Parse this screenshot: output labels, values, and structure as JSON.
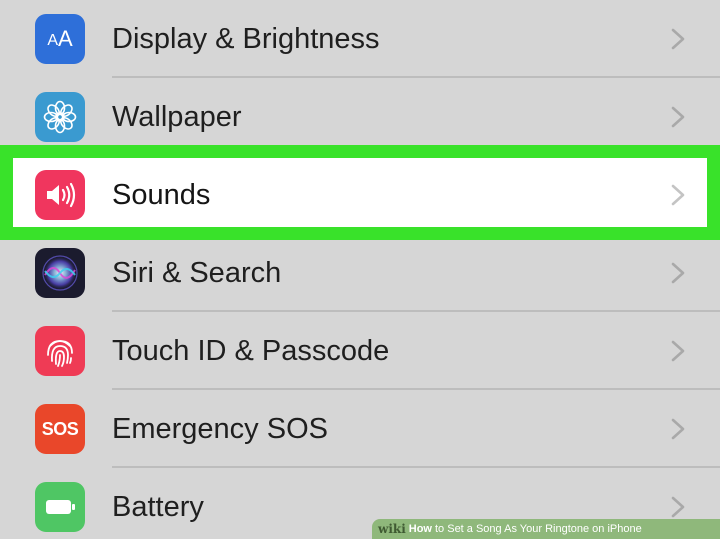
{
  "settings_rows": [
    {
      "label": "Display & Brightness",
      "icon": "display-brightness-icon",
      "icon_color": "#2e6fd9"
    },
    {
      "label": "Wallpaper",
      "icon": "wallpaper-flower-icon",
      "icon_color": "#3a9ad0"
    },
    {
      "label": "Sounds",
      "icon": "speaker-icon",
      "icon_color": "#f0365e",
      "highlighted": true
    },
    {
      "label": "Siri & Search",
      "icon": "siri-icon",
      "icon_color": "#1b1b2e"
    },
    {
      "label": "Touch ID & Passcode",
      "icon": "fingerprint-icon",
      "icon_color": "#ef3b55"
    },
    {
      "label": "Emergency SOS",
      "icon": "sos-icon",
      "icon_color": "#e9472a",
      "icon_text": "SOS"
    },
    {
      "label": "Battery",
      "icon": "battery-icon",
      "icon_color": "#4fc664"
    }
  ],
  "display_icon_text": {
    "small": "A",
    "large": "A"
  },
  "highlight_color": "#39e22a",
  "watermark": {
    "brand": "wiki",
    "how": "How",
    "rest": "to Set a Song As Your Ringtone on iPhone"
  }
}
